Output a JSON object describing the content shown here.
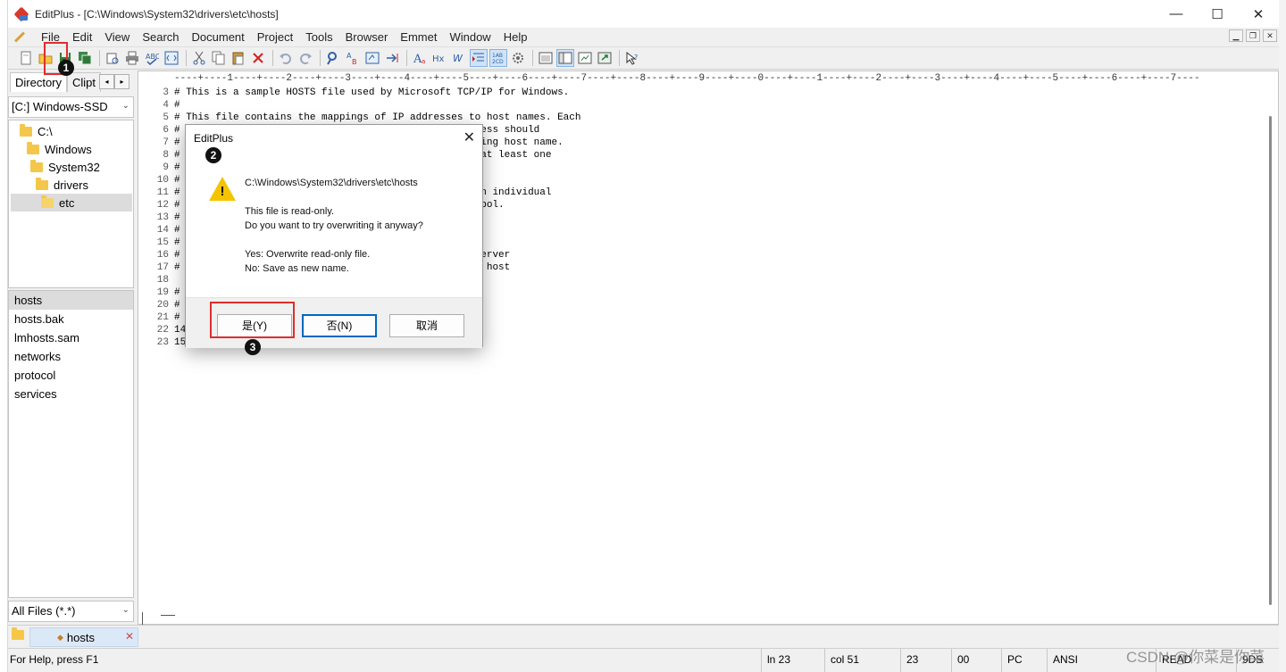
{
  "window": {
    "title": "EditPlus - [C:\\Windows\\System32\\drivers\\etc\\hosts]",
    "controls": {
      "minimize": "—",
      "maximize": "☐",
      "close": "✕"
    }
  },
  "menu": [
    "File",
    "Edit",
    "View",
    "Search",
    "Document",
    "Project",
    "Tools",
    "Browser",
    "Emmet",
    "Window",
    "Help"
  ],
  "mdi_controls": {
    "minimize": "▁",
    "restore": "❐",
    "close": "✕"
  },
  "toolbar": {
    "icons": [
      "new-file-icon",
      "open-folder-icon",
      "save-icon",
      "save-all-icon",
      "print-preview-icon",
      "print-icon",
      "spell-check-icon",
      "html-toolbar-icon",
      "cut-icon",
      "copy-icon",
      "paste-icon",
      "delete-icon",
      "undo-icon",
      "redo-icon",
      "find-icon",
      "replace-icon",
      "browser-icon",
      "goto-icon",
      "font-icon",
      "hex-icon",
      "word-wrap-icon",
      "indent-icon",
      "column-icon",
      "settings-icon",
      "fullscreen-icon",
      "output-window-icon",
      "cliptext-icon",
      "directory-icon",
      "help-cursor-icon"
    ]
  },
  "annotations": {
    "step1": "1",
    "step2": "2",
    "step3": "3"
  },
  "left_panel": {
    "tabs": [
      "Directory",
      "Clipt"
    ],
    "tab_arrows": {
      "left": "◂",
      "right": "▸"
    },
    "drive": "[C:] Windows-SSD",
    "tree": [
      "C:\\",
      "Windows",
      "System32",
      "drivers",
      "etc"
    ],
    "files": [
      "hosts",
      "hosts.bak",
      "lmhosts.sam",
      "networks",
      "protocol",
      "services"
    ],
    "filter": "All Files (*.*)"
  },
  "editor": {
    "ruler": "----+----1----+----2----+----3----+----4----+----5----+----6----+----7----+----8----+----9----+----0----+----1----+----2----+----3----+----4----+----5----+----6----+----7----",
    "lines": [
      {
        "num": "3",
        "text": "# This is a sample HOSTS file used by Microsoft TCP/IP for Windows."
      },
      {
        "num": "4",
        "text": "#"
      },
      {
        "num": "5",
        "text": "# This file contains the mappings of IP addresses to host names. Each"
      },
      {
        "num": "6",
        "text": "#                                            IP address should"
      },
      {
        "num": "7",
        "text": "#                                          orresponding host name."
      },
      {
        "num": "8",
        "text": "#                                          rated by at least one"
      },
      {
        "num": "9",
        "text": "#"
      },
      {
        "num": "10",
        "text": "#"
      },
      {
        "num": "11",
        "text": "#                                          nserted on individual"
      },
      {
        "num": "12",
        "text": "#                                          a '#' symbol."
      },
      {
        "num": "13",
        "text": "#"
      },
      {
        "num": "14",
        "text": "#"
      },
      {
        "num": "15",
        "text": "#"
      },
      {
        "num": "16",
        "text": "#                                           source server"
      },
      {
        "num": "17",
        "text": "#                                           x client host"
      },
      {
        "num": "18",
        "text": ""
      },
      {
        "num": "19",
        "text": "#                                           itself."
      },
      {
        "num": "20",
        "text": "#"
      },
      {
        "num": "21",
        "text": "#"
      },
      {
        "num": "22",
        "text": "14"
      },
      {
        "num": "23",
        "text": "15"
      }
    ]
  },
  "doc_tab": {
    "label": "hosts",
    "close": "✕"
  },
  "status": {
    "help": "For Help, press F1",
    "line": "ln 23",
    "col": "col 51",
    "total": "23",
    "code": "00",
    "mode": "PC",
    "encoding": "ANSI",
    "readonly": "READ",
    "extra": "9DS"
  },
  "watermark": "CSDN @你菜是你菜",
  "dialog": {
    "title": "EditPlus",
    "close": "✕",
    "path": "C:\\Windows\\System32\\drivers\\etc\\hosts",
    "message1": "This file is read-only.",
    "message2": "Do you want to try overwriting it anyway?",
    "yes_desc": "Yes: Overwrite read-only file.",
    "no_desc": "No: Save as new name.",
    "buttons": {
      "yes": "是(Y)",
      "no": "否(N)",
      "cancel": "取消"
    }
  }
}
